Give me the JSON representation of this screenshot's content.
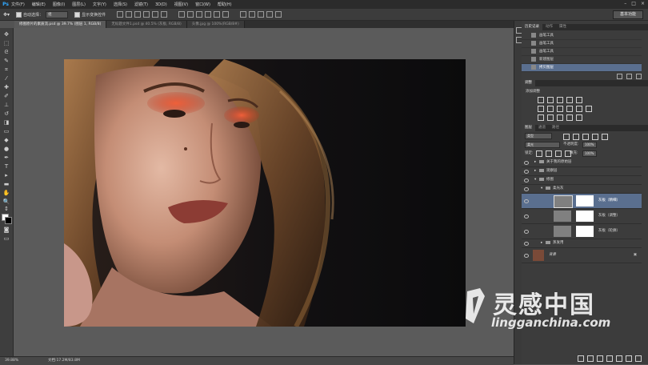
{
  "app": {
    "logo": "Ps"
  },
  "menu": [
    "文件(F)",
    "编辑(E)",
    "图像(I)",
    "图层(L)",
    "文字(Y)",
    "选择(S)",
    "滤镜(T)",
    "3D(D)",
    "视图(V)",
    "窗口(W)",
    "帮助(H)"
  ],
  "options": {
    "auto_select_label": "自动选择：",
    "auto_select_value": "组",
    "show_transform_label": "显示变换控件",
    "workspace": "基本功能"
  },
  "tabs": [
    {
      "label": "修图原片的素质流.psd @ 39.7% (图层 1, RGB/8)",
      "active": true
    },
    {
      "label": "无标题文件1.psd @ 40.5% (灰板, RGB/8)",
      "active": false
    },
    {
      "label": "头像.jpg @ 100%(RGB/8#)",
      "active": false
    }
  ],
  "status": {
    "zoom": "39.88%",
    "doc": "文档:17.2M/83.8M"
  },
  "history": {
    "tabs": [
      "历史记录",
      "动作",
      "属性"
    ],
    "items": [
      {
        "label": "画笔工具",
        "selected": false
      },
      {
        "label": "画笔工具",
        "selected": false
      },
      {
        "label": "画笔工具",
        "selected": false
      },
      {
        "label": "新建图层",
        "selected": false
      },
      {
        "label": "拷贝图层",
        "selected": true
      }
    ]
  },
  "adjustments": {
    "tab": "调整",
    "label": "添加调整"
  },
  "layers": {
    "tabs": [
      "图层",
      "通道",
      "路径"
    ],
    "kind": "类型",
    "blend": "柔光",
    "opacity_label": "不透明度:",
    "opacity": "100%",
    "lock_label": "锁定:",
    "fill_label": "填充:",
    "fill": "100%",
    "rows": [
      {
        "name": "关于我的原始层",
        "type": "group"
      },
      {
        "name": "观察层",
        "type": "group"
      },
      {
        "name": "修图",
        "type": "group"
      },
      {
        "name": "柔光灰",
        "type": "group"
      },
      {
        "name": "灰板（精细）",
        "type": "layer",
        "selected": true
      },
      {
        "name": "灰板（调整）",
        "type": "layer"
      },
      {
        "name": "灰板（轮廓）",
        "type": "layer"
      },
      {
        "name": "蒸发用",
        "type": "group"
      },
      {
        "name": "背景",
        "type": "background"
      }
    ]
  },
  "watermark": {
    "cn": "灵感中国",
    "en": "lingganchina.com"
  },
  "colors": {
    "selection": "#5a6f8f",
    "eye_shadow": "#e8502c",
    "ps_blue": "#31a8ff"
  }
}
